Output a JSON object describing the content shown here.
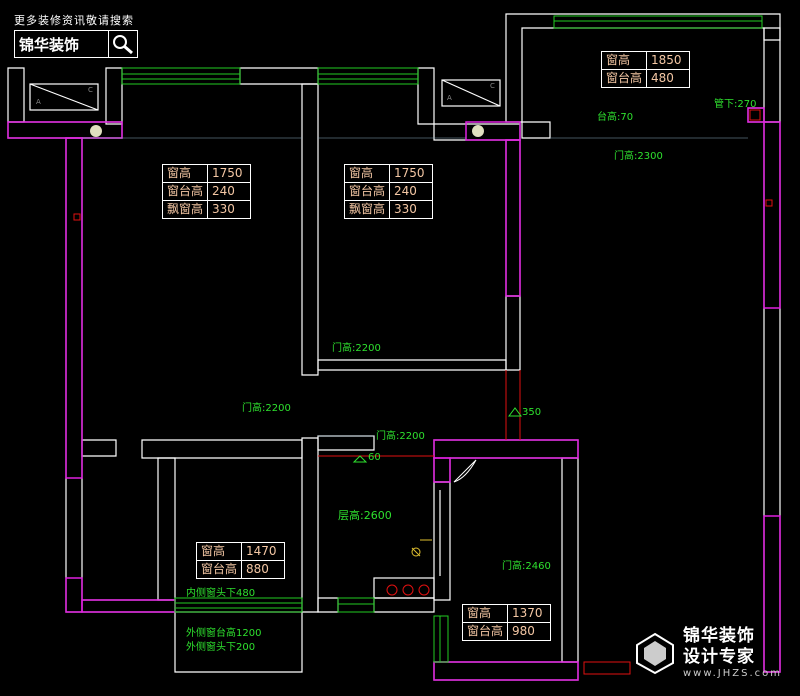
{
  "banner": {
    "top_text": "更多装修资讯敬请搜索",
    "brand": "锦华装饰",
    "search_icon": "search-icon"
  },
  "window_tables": [
    {
      "id": "bedroom-left",
      "rows": [
        [
          "窗高",
          "1750"
        ],
        [
          "窗台高",
          "240"
        ],
        [
          "飘窗高",
          "330"
        ]
      ]
    },
    {
      "id": "bedroom-middle",
      "rows": [
        [
          "窗高",
          "1750"
        ],
        [
          "窗台高",
          "240"
        ],
        [
          "飘窗高",
          "330"
        ]
      ]
    },
    {
      "id": "balcony",
      "rows": [
        [
          "窗高",
          "1850"
        ],
        [
          "窗台高",
          "480"
        ]
      ]
    },
    {
      "id": "study",
      "rows": [
        [
          "窗高",
          "1470"
        ],
        [
          "窗台高",
          "880"
        ]
      ]
    },
    {
      "id": "kitchen",
      "rows": [
        [
          "窗高",
          "1370"
        ],
        [
          "窗台高",
          "980"
        ]
      ]
    }
  ],
  "labels": {
    "pipe_below": "管下:270",
    "sill_height": "台高:70",
    "door_height_living": "门高:2300",
    "door_height_mid": "门高:2200",
    "door_height_left": "门高:2200",
    "door_height_corridor": "门高:2200",
    "level_350": "350",
    "level_60": "60",
    "floor_height": "层高:2600",
    "door_height_kitchen": "门高:2460",
    "inner_window_head": "内侧窗头下480",
    "outer_sill": "外侧窗台高1200",
    "outer_head": "外侧窗头下200"
  },
  "watermark": {
    "brand": "锦华装饰",
    "sub": "设计专家",
    "url": "www.JHZS.com"
  },
  "colors": {
    "wall": "#ffffff",
    "wall_hatch": "#e020e0",
    "window": "#22cc22",
    "label": "#2ee02e",
    "table_text": "#f4c7a4",
    "dim_red": "#e01010"
  }
}
